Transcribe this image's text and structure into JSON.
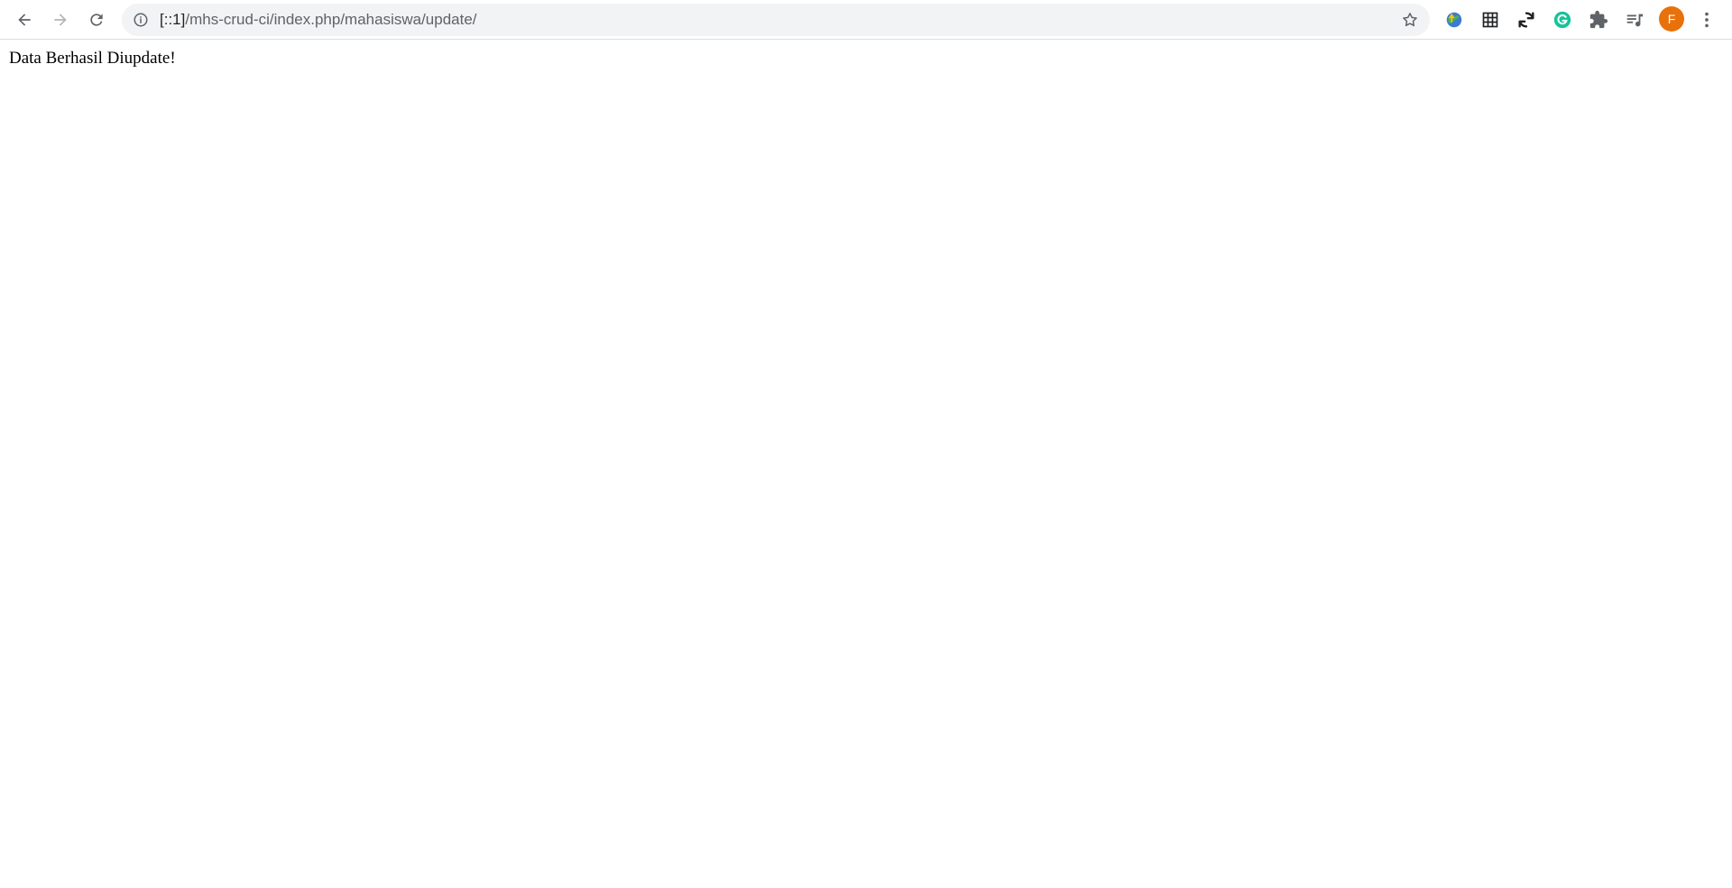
{
  "browser": {
    "url_host": "[::1]",
    "url_path": "/mhs-crud-ci/index.php/mahasiswa/update/",
    "icons": {
      "back": "arrow-left-icon",
      "forward": "arrow-right-icon",
      "reload": "reload-icon",
      "site_info": "info-circle-icon",
      "bookmark": "star-icon",
      "extensions": [
        "idm-globe-icon",
        "grid-table-icon",
        "sync-arrows-icon",
        "grammarly-icon",
        "puzzle-icon",
        "media-playlist-icon"
      ],
      "menu": "kebab-menu-icon"
    },
    "profile": {
      "initial": "F",
      "color": "#e8710a"
    },
    "colors": {
      "toolbar_bg": "#ffffff",
      "omnibox_bg": "#f1f3f4",
      "icon": "#5f6368",
      "grammarly": "#15c39a"
    }
  },
  "page": {
    "message": "Data Berhasil Diupdate!"
  }
}
